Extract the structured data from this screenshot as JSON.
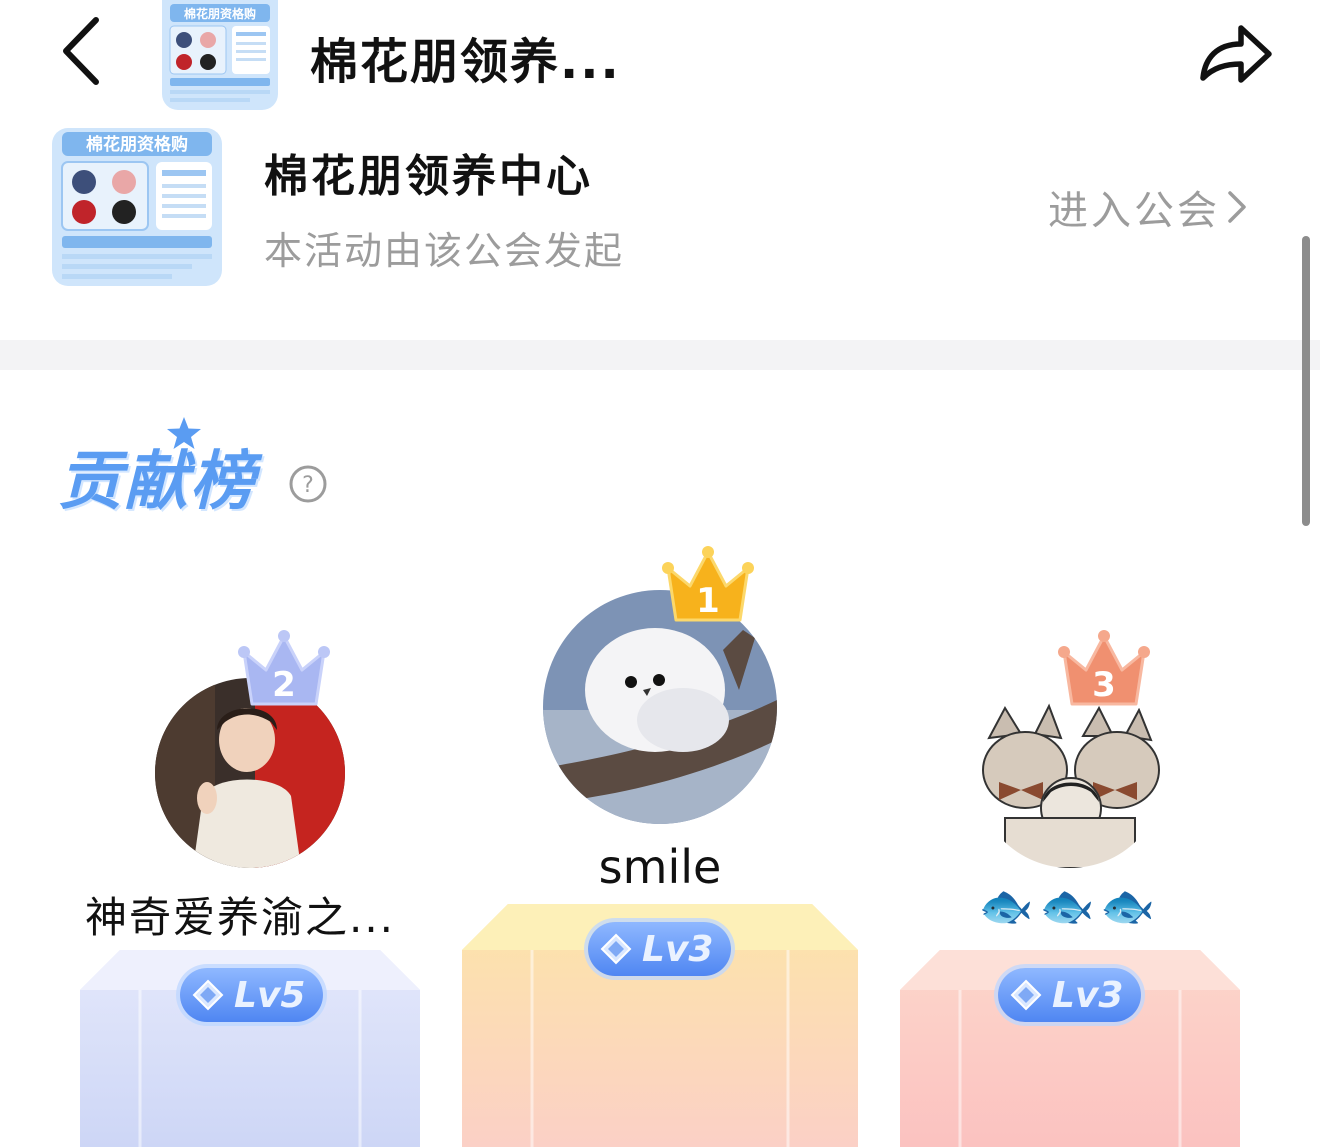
{
  "header": {
    "title": "棉花朋领养..."
  },
  "thumbnail": {
    "banner_text": "棉花朋资格购"
  },
  "guild": {
    "name": "棉花朋领养中心",
    "subtitle": "本活动由该公会发起",
    "enter_label": "进入公会"
  },
  "ranking": {
    "title": "贡献榜",
    "entries": [
      {
        "rank": "2",
        "name": "神奇爱养渝之...",
        "level": "Lv5"
      },
      {
        "rank": "1",
        "name": "smile",
        "level": "Lv3"
      },
      {
        "rank": "3",
        "name": "🐟🐟🐟",
        "level": "Lv3"
      }
    ]
  },
  "colors": {
    "accent_blue": "#5a9cf2",
    "gray_text": "#9c9c9c",
    "crown_gold": "#f7b21c",
    "crown_silver": "#a9b7f2",
    "crown_bronze": "#f09070"
  },
  "icons": [
    "back-arrow-icon",
    "share-icon",
    "chevron-right-icon",
    "help-icon",
    "crown-icon",
    "gem-icon"
  ]
}
